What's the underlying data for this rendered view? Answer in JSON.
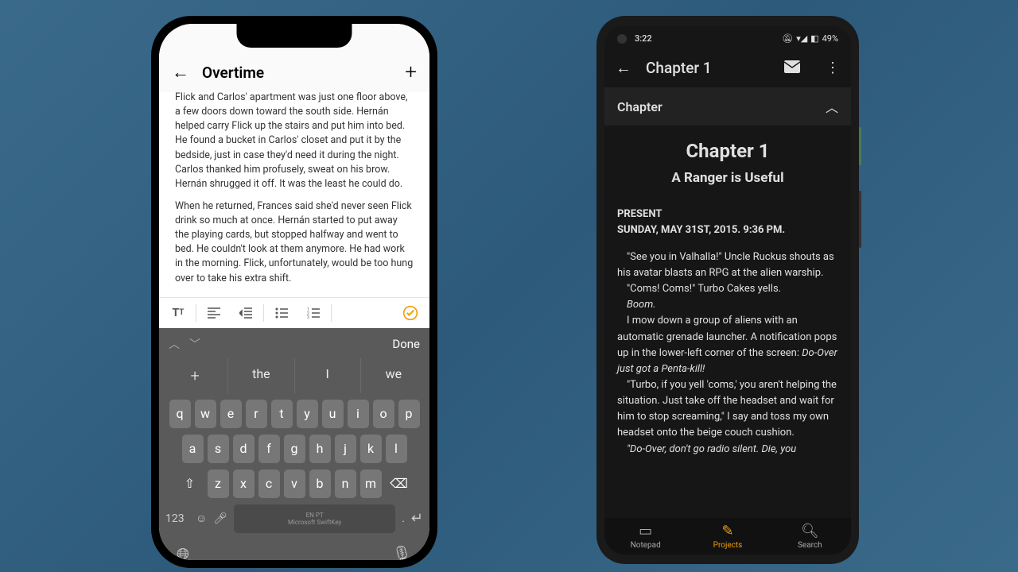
{
  "ios": {
    "title": "Overtime",
    "para1": "Flick and Carlos' apartment was just one floor above, a few doors down toward the south side. Hernán helped carry Flick up the stairs and put him into bed. He found a bucket in Carlos' closet and put it by the bedside, just in case they'd need it during the night. Carlos thanked him profusely, sweat on his brow. Hernán shrugged it off. It was the least he could do.",
    "para2": "When he returned, Frances said she'd never seen Flick drink so much at once. Hernán started to put away the playing cards, but stopped halfway and went to bed. He couldn't look at them anymore. He had work in the morning. Flick, unfortunately, would be too hung over to take his extra shift.",
    "done": "Done",
    "sug_plus": "+",
    "sug_the": "the",
    "sug_i": "I",
    "sug_we": "we",
    "row1": [
      "q",
      "w",
      "e",
      "r",
      "t",
      "y",
      "u",
      "i",
      "o",
      "p"
    ],
    "row2": [
      "a",
      "s",
      "d",
      "f",
      "g",
      "h",
      "j",
      "k",
      "l"
    ],
    "row3": [
      "z",
      "x",
      "c",
      "v",
      "b",
      "n",
      "m"
    ],
    "k123": "123",
    "space_top": "EN PT",
    "space_bot": "Microsoft SwiftKey"
  },
  "android": {
    "time": "3:22",
    "battery": "49%",
    "header_title": "Chapter 1",
    "section_label": "Chapter",
    "chapter_title": "Chapter 1",
    "chapter_subtitle": "A Ranger is Useful",
    "present": "PRESENT",
    "datetime": "SUNDAY, MAY 31ST, 2015. 9:36 PM.",
    "p1": "\"See you in Valhalla!\" Uncle Ruckus shouts as his avatar blasts an RPG at the alien warship.",
    "p2": "\"Coms! Coms!\" Turbo Cakes yells.",
    "p3": "Boom.",
    "p4a": "I mow down a group of aliens with an automatic grenade launcher. A notification pops up in the lower-left corner of the screen: ",
    "p4b": "Do-Over just got a Penta-kill!",
    "p5": "\"Turbo, if you yell 'coms,' you aren't helping the situation. Just take off the headset and wait for him to stop screaming,\" I say and toss my own headset onto the beige couch cushion.",
    "p6": "\"Do-Over, don't go radio silent. Die, you",
    "nav": {
      "notepad": "Notepad",
      "projects": "Projects",
      "search": "Search"
    }
  }
}
